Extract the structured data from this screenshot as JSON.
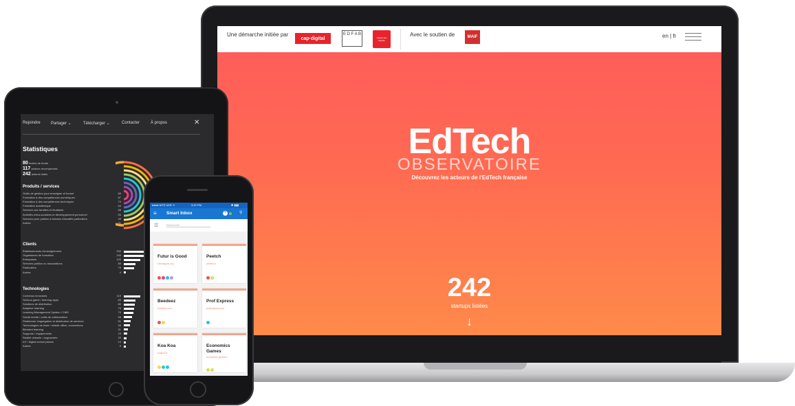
{
  "laptop": {
    "header": {
      "intro": "Une démarche initiée par",
      "partner1": "cap·digital",
      "partner2": "E D F A B",
      "partner3": "Caisse des Dépôts",
      "support_label": "Avec le soutien de",
      "sponsor": "MAIF",
      "lang": "en | fr"
    },
    "hero": {
      "title": "EdTech",
      "subtitle": "OBSERVATOIRE",
      "tagline": "Découvrez les acteurs de l'EdTech française",
      "count": "242",
      "count_label": "startups listées",
      "arrow": "↓"
    }
  },
  "tablet": {
    "nav": [
      "Rejoindre",
      "Partager ⌄",
      "Télécharger ⌄",
      "Contacter",
      "À propos"
    ],
    "close": "✕",
    "stats_title": "Statistiques",
    "summary": [
      {
        "num": "80",
        "label": "levées de fonds"
      },
      {
        "num": "117",
        "label": "acteurs récompensés"
      },
      {
        "num": "242",
        "label": "acteurs listés"
      }
    ],
    "sections": [
      {
        "title": "Produits / services",
        "rows": [
          {
            "label": "Outils de gestion pour enseigner et former",
            "value": "89"
          },
          {
            "label": "Formation à des compétences numériques",
            "value": "87"
          },
          {
            "label": "Formation à des compétences techniques",
            "value": "79"
          },
          {
            "label": "Formation académique",
            "value": "64"
          },
          {
            "label": "Services aux familles et étudiants",
            "value": "58"
          },
          {
            "label": "Activités extra-scolaires et développement personnel",
            "value": "55"
          },
          {
            "label": "Services pour publics à besoins éducatifs particuliers",
            "value": "49"
          },
          {
            "label": "Autres",
            "value": "31"
          }
        ]
      },
      {
        "title": "Clients",
        "rows": [
          {
            "label": "Établissements d'enseignement",
            "value": "150"
          },
          {
            "label": "Organismes de formation",
            "value": "145"
          },
          {
            "label": "Entreprises",
            "value": "120"
          },
          {
            "label": "Services publics ou associations",
            "value": "85"
          },
          {
            "label": "Particuliers",
            "value": "75"
          },
          {
            "label": "Autres",
            "value": "4"
          }
        ]
      },
      {
        "title": "Technologies",
        "rows": [
          {
            "label": "Contenus innovants",
            "value": "119"
          },
          {
            "label": "Serious game / learning apps",
            "value": "83"
          },
          {
            "label": "Solutions de distribution",
            "value": "80"
          },
          {
            "label": "Adaptive learning",
            "value": "75"
          },
          {
            "label": "Learning Management System / CMS",
            "value": "70"
          },
          {
            "label": "Social media / outils de collaboration",
            "value": "58"
          },
          {
            "label": "Plateforme d'agrégation et distribution de services",
            "value": "51"
          },
          {
            "label": "Technologies de back / middle office, connections",
            "value": "45"
          },
          {
            "label": "Blended learning",
            "value": "31"
          },
          {
            "label": "Supports / équipements",
            "value": "23"
          },
          {
            "label": "Réalité virtuelle / augmentée",
            "value": "20"
          },
          {
            "label": "IoT / digital school places",
            "value": "14"
          },
          {
            "label": "Autres",
            "value": "9"
          }
        ]
      }
    ]
  },
  "phone": {
    "status_left": "●●●● MTS UKR ᯤ",
    "status_time": "3:42 PM",
    "status_right": "✱ ▮▮▮",
    "app_title": "Smart Inbox",
    "search_placeholder": "Recherche",
    "cards": [
      {
        "title": "Futur is Good",
        "url": "futurisgood.org",
        "dots": [
          "#ef5350",
          "#ec407a",
          "#26c6da",
          "#b39ddb"
        ]
      },
      {
        "title": "Peetch",
        "url": "peetch.io",
        "dots": [
          "#ef5350",
          "#d4e157"
        ]
      },
      {
        "title": "Beedeez",
        "url": "beedeez.com",
        "dots": [
          "#ef5350",
          "#d4e157"
        ]
      },
      {
        "title": "Prof Express",
        "url": "profexpress.com",
        "dots": [
          "#26c6da"
        ]
      },
      {
        "title": "Koa Koa",
        "url": "koakoa.fr",
        "dots": [
          "#ffd54f",
          "#26c6da",
          "#26c6da"
        ]
      },
      {
        "title": "Economics Games",
        "url": "economics-games.c",
        "dots": [
          "#d4e157",
          "#d4e157"
        ]
      }
    ]
  },
  "colors": {
    "hero_top": "#ff5a5c",
    "hero_bottom": "#ff8a4a",
    "phone_bar": "#1976d2",
    "card_accent": "#f6a58a"
  }
}
